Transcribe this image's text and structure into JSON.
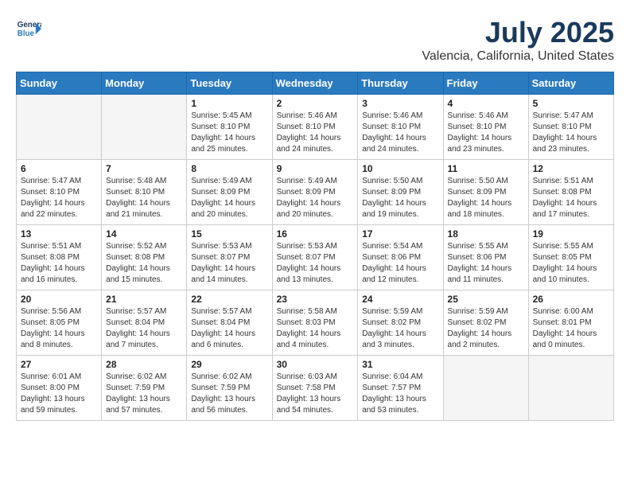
{
  "header": {
    "logo_line1": "General",
    "logo_line2": "Blue",
    "title": "July 2025",
    "subtitle": "Valencia, California, United States"
  },
  "weekdays": [
    "Sunday",
    "Monday",
    "Tuesday",
    "Wednesday",
    "Thursday",
    "Friday",
    "Saturday"
  ],
  "weeks": [
    [
      {
        "day": "",
        "detail": ""
      },
      {
        "day": "",
        "detail": ""
      },
      {
        "day": "1",
        "detail": "Sunrise: 5:45 AM\nSunset: 8:10 PM\nDaylight: 14 hours\nand 25 minutes."
      },
      {
        "day": "2",
        "detail": "Sunrise: 5:46 AM\nSunset: 8:10 PM\nDaylight: 14 hours\nand 24 minutes."
      },
      {
        "day": "3",
        "detail": "Sunrise: 5:46 AM\nSunset: 8:10 PM\nDaylight: 14 hours\nand 24 minutes."
      },
      {
        "day": "4",
        "detail": "Sunrise: 5:46 AM\nSunset: 8:10 PM\nDaylight: 14 hours\nand 23 minutes."
      },
      {
        "day": "5",
        "detail": "Sunrise: 5:47 AM\nSunset: 8:10 PM\nDaylight: 14 hours\nand 23 minutes."
      }
    ],
    [
      {
        "day": "6",
        "detail": "Sunrise: 5:47 AM\nSunset: 8:10 PM\nDaylight: 14 hours\nand 22 minutes."
      },
      {
        "day": "7",
        "detail": "Sunrise: 5:48 AM\nSunset: 8:10 PM\nDaylight: 14 hours\nand 21 minutes."
      },
      {
        "day": "8",
        "detail": "Sunrise: 5:49 AM\nSunset: 8:09 PM\nDaylight: 14 hours\nand 20 minutes."
      },
      {
        "day": "9",
        "detail": "Sunrise: 5:49 AM\nSunset: 8:09 PM\nDaylight: 14 hours\nand 20 minutes."
      },
      {
        "day": "10",
        "detail": "Sunrise: 5:50 AM\nSunset: 8:09 PM\nDaylight: 14 hours\nand 19 minutes."
      },
      {
        "day": "11",
        "detail": "Sunrise: 5:50 AM\nSunset: 8:09 PM\nDaylight: 14 hours\nand 18 minutes."
      },
      {
        "day": "12",
        "detail": "Sunrise: 5:51 AM\nSunset: 8:08 PM\nDaylight: 14 hours\nand 17 minutes."
      }
    ],
    [
      {
        "day": "13",
        "detail": "Sunrise: 5:51 AM\nSunset: 8:08 PM\nDaylight: 14 hours\nand 16 minutes."
      },
      {
        "day": "14",
        "detail": "Sunrise: 5:52 AM\nSunset: 8:08 PM\nDaylight: 14 hours\nand 15 minutes."
      },
      {
        "day": "15",
        "detail": "Sunrise: 5:53 AM\nSunset: 8:07 PM\nDaylight: 14 hours\nand 14 minutes."
      },
      {
        "day": "16",
        "detail": "Sunrise: 5:53 AM\nSunset: 8:07 PM\nDaylight: 14 hours\nand 13 minutes."
      },
      {
        "day": "17",
        "detail": "Sunrise: 5:54 AM\nSunset: 8:06 PM\nDaylight: 14 hours\nand 12 minutes."
      },
      {
        "day": "18",
        "detail": "Sunrise: 5:55 AM\nSunset: 8:06 PM\nDaylight: 14 hours\nand 11 minutes."
      },
      {
        "day": "19",
        "detail": "Sunrise: 5:55 AM\nSunset: 8:05 PM\nDaylight: 14 hours\nand 10 minutes."
      }
    ],
    [
      {
        "day": "20",
        "detail": "Sunrise: 5:56 AM\nSunset: 8:05 PM\nDaylight: 14 hours\nand 8 minutes."
      },
      {
        "day": "21",
        "detail": "Sunrise: 5:57 AM\nSunset: 8:04 PM\nDaylight: 14 hours\nand 7 minutes."
      },
      {
        "day": "22",
        "detail": "Sunrise: 5:57 AM\nSunset: 8:04 PM\nDaylight: 14 hours\nand 6 minutes."
      },
      {
        "day": "23",
        "detail": "Sunrise: 5:58 AM\nSunset: 8:03 PM\nDaylight: 14 hours\nand 4 minutes."
      },
      {
        "day": "24",
        "detail": "Sunrise: 5:59 AM\nSunset: 8:02 PM\nDaylight: 14 hours\nand 3 minutes."
      },
      {
        "day": "25",
        "detail": "Sunrise: 5:59 AM\nSunset: 8:02 PM\nDaylight: 14 hours\nand 2 minutes."
      },
      {
        "day": "26",
        "detail": "Sunrise: 6:00 AM\nSunset: 8:01 PM\nDaylight: 14 hours\nand 0 minutes."
      }
    ],
    [
      {
        "day": "27",
        "detail": "Sunrise: 6:01 AM\nSunset: 8:00 PM\nDaylight: 13 hours\nand 59 minutes."
      },
      {
        "day": "28",
        "detail": "Sunrise: 6:02 AM\nSunset: 7:59 PM\nDaylight: 13 hours\nand 57 minutes."
      },
      {
        "day": "29",
        "detail": "Sunrise: 6:02 AM\nSunset: 7:59 PM\nDaylight: 13 hours\nand 56 minutes."
      },
      {
        "day": "30",
        "detail": "Sunrise: 6:03 AM\nSunset: 7:58 PM\nDaylight: 13 hours\nand 54 minutes."
      },
      {
        "day": "31",
        "detail": "Sunrise: 6:04 AM\nSunset: 7:57 PM\nDaylight: 13 hours\nand 53 minutes."
      },
      {
        "day": "",
        "detail": ""
      },
      {
        "day": "",
        "detail": ""
      }
    ]
  ]
}
